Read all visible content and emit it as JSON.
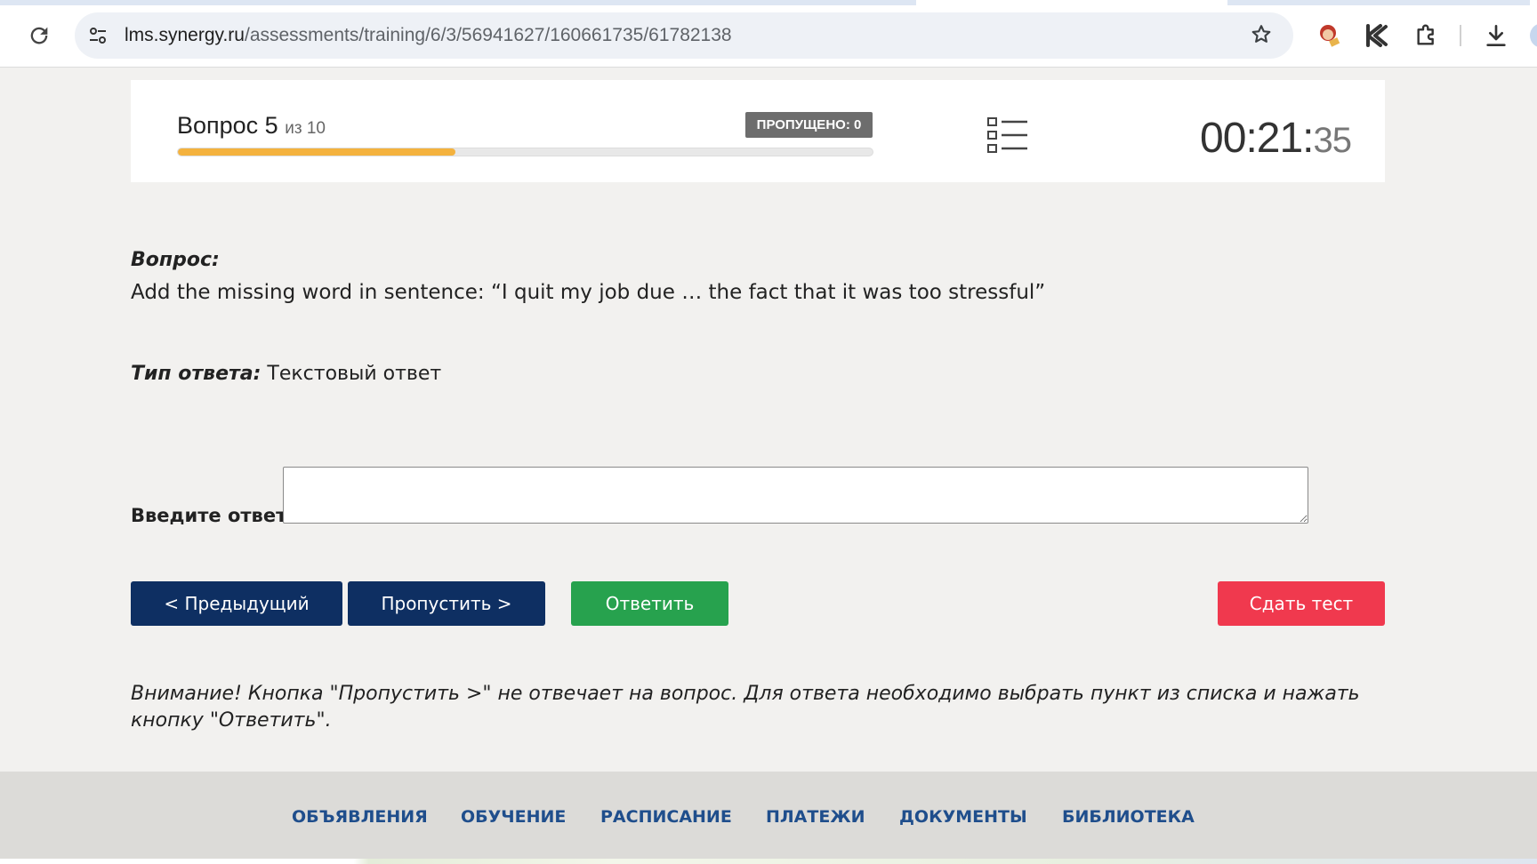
{
  "browser": {
    "url_host": "lms.synergy.ru",
    "url_path": "/assessments/training/6/3/56941627/160661735/61782138",
    "icons": {
      "reload": "reload-icon",
      "site_info": "site-settings-icon",
      "bookmark": "star-icon",
      "extensions": [
        "extension-avatar-icon",
        "extension-k-icon",
        "puzzle-icon"
      ],
      "download": "download-icon"
    }
  },
  "header": {
    "question_label": "Вопрос 5",
    "question_of": "из 10",
    "skipped_badge": "ПРОПУЩЕНО: 0",
    "progress_fraction": 0.4,
    "timer_main": "00:21:",
    "timer_seconds": "35",
    "colors": {
      "progress": "#f4b23e"
    }
  },
  "question": {
    "label": "Вопрос:",
    "text": "Add the missing word in sentence: “I quit my job due … the fact that it was too stressful”",
    "answer_type_label": "Тип ответа:",
    "answer_type_value": "Текстовый ответ",
    "input_label": "Введите ответ:",
    "input_value": ""
  },
  "buttons": {
    "prev": "< Предыдущий",
    "skip": "Пропустить >",
    "answer": "Ответить",
    "submit": "Сдать тест",
    "colors": {
      "nav": "#0e2f62",
      "answer": "#27a24e",
      "submit": "#f0394e"
    }
  },
  "warning": "Внимание! Кнопка \"Пропустить >\" не отвечает на вопрос. Для ответа необходимо выбрать пункт из списка и нажать кнопку \"Ответить\".",
  "footer": {
    "links": [
      "ОБЪЯВЛЕНИЯ",
      "ОБУЧЕНИЕ",
      "РАСПИСАНИЕ",
      "ПЛАТЕЖИ",
      "ДОКУМЕНТЫ",
      "БИБЛИОТЕКА"
    ]
  }
}
